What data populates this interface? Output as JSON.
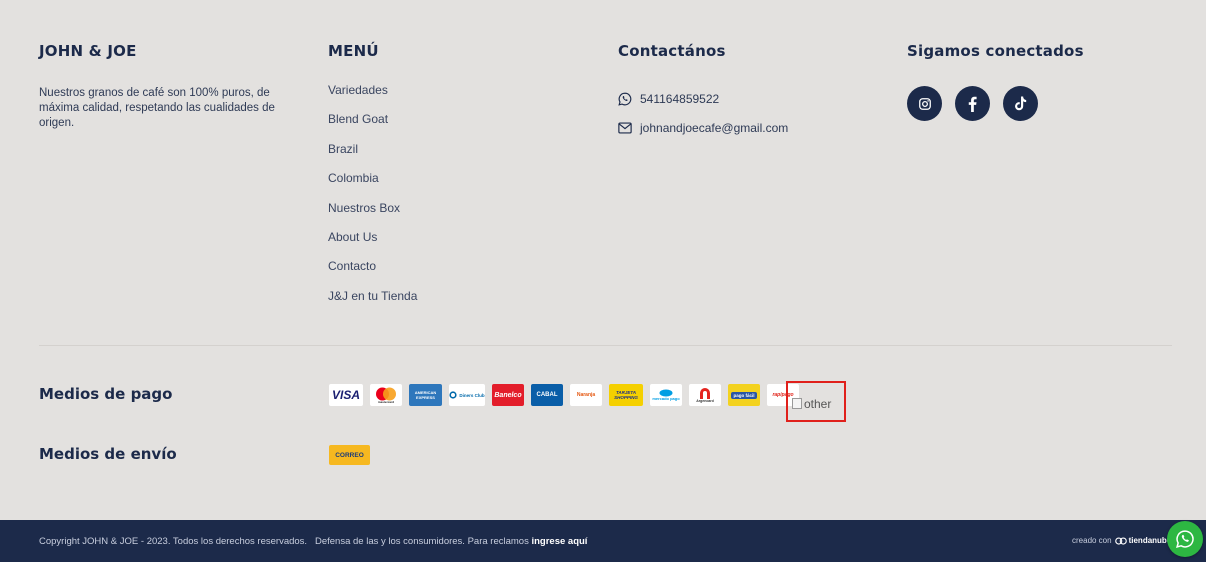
{
  "brand": {
    "title": "JOHN & JOE",
    "about": "Nuestros granos de café son 100% puros, de máxima calidad, respetando las cualidades de origen."
  },
  "menu": {
    "title": "MENÚ",
    "items": [
      {
        "label": "Variedades"
      },
      {
        "label": "Blend Goat"
      },
      {
        "label": "Brazil"
      },
      {
        "label": "Colombia"
      },
      {
        "label": "Nuestros Box"
      },
      {
        "label": "About Us"
      },
      {
        "label": "Contacto"
      },
      {
        "label": "J&J en tu Tienda"
      }
    ]
  },
  "contact": {
    "title": "Contactános",
    "phone": "541164859522",
    "email": "johnandjoecafe@gmail.com"
  },
  "social": {
    "title": "Sigamos conectados",
    "icons": [
      "instagram-icon",
      "facebook-icon",
      "tiktok-icon"
    ]
  },
  "payments": {
    "label": "Medios de pago",
    "methods": [
      {
        "name": "VISA"
      },
      {
        "name": "mastercard"
      },
      {
        "name": "AMERICAN EXPRESS"
      },
      {
        "name": "Diners Club"
      },
      {
        "name": "Banelco"
      },
      {
        "name": "CABAL"
      },
      {
        "name": "Naranja"
      },
      {
        "name": "TARJETA SHOPPING"
      },
      {
        "name": "mercado pago"
      },
      {
        "name": "Argencard"
      },
      {
        "name": "pago fácil"
      },
      {
        "name": "rapipago"
      }
    ],
    "other_alt": "other"
  },
  "shipping": {
    "label": "Medios de envío",
    "methods": [
      {
        "name": "CORREO"
      }
    ]
  },
  "bottom": {
    "copyright": "Copyright JOHN & JOE - 2023. Todos los derechos reservados.",
    "consumer": "Defensa de las y los consumidores. Para reclamos",
    "consumer_link": "ingrese aquí",
    "creado": "creado con",
    "platform": "tiendanube"
  },
  "colors": {
    "background": "#e3e1df",
    "navy": "#1c2a4a",
    "highlight": "#e0201b",
    "whatsapp": "#2db742"
  }
}
